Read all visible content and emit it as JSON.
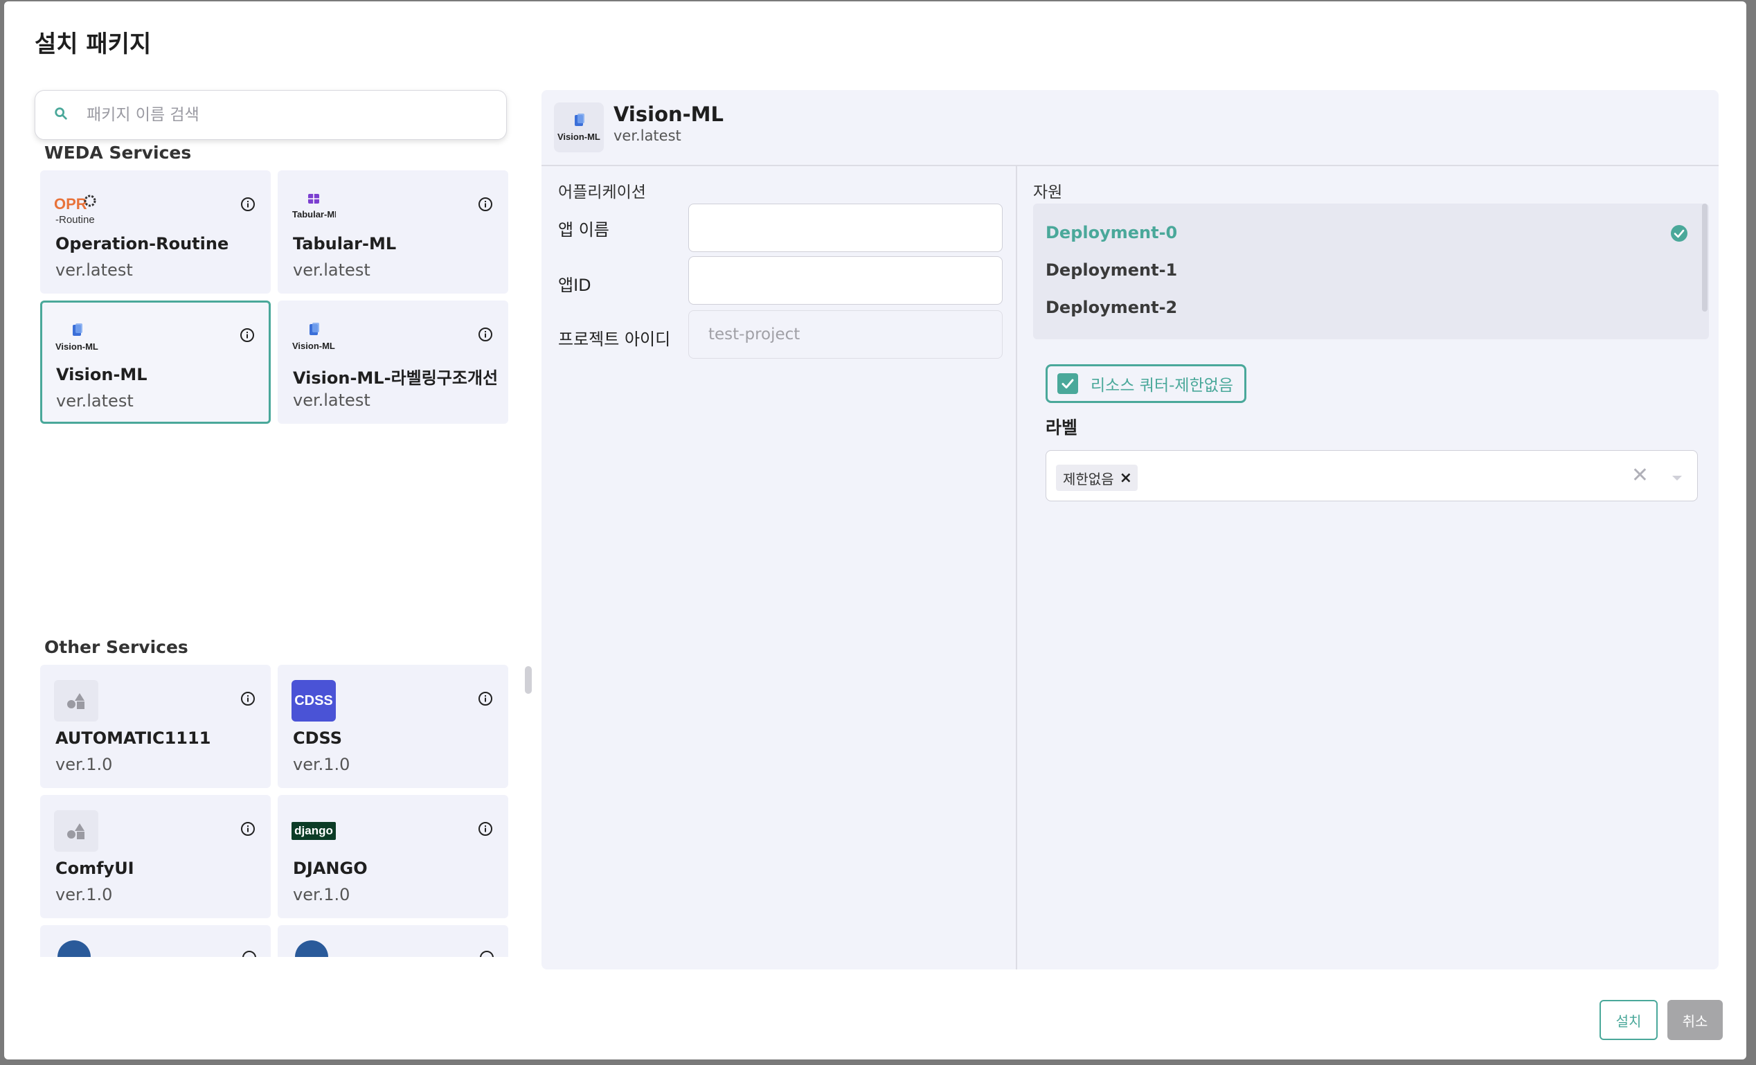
{
  "modal": {
    "title": "설치 패키지"
  },
  "search": {
    "placeholder": "패키지 이름 검색"
  },
  "weda_section": {
    "title": "WEDA Services",
    "cards": [
      {
        "name": "Operation-Routine",
        "version": "ver.latest",
        "logo_text": "OPR",
        "logo_sub": "-Routine"
      },
      {
        "name": "Tabular-ML",
        "version": "ver.latest",
        "logo_text": "Tabular-ML"
      },
      {
        "name": "Vision-ML",
        "version": "ver.latest",
        "logo_text": "Vision-ML",
        "selected": true
      },
      {
        "name": "Vision-ML-라벨링구조개선",
        "version": "ver.latest",
        "logo_text": "Vision-ML"
      }
    ]
  },
  "other_section": {
    "title": "Other Services",
    "cards": [
      {
        "name": "AUTOMATIC1111",
        "version": "ver.1.0"
      },
      {
        "name": "CDSS",
        "version": "ver.1.0",
        "logo_text": "CDSS"
      },
      {
        "name": "ComfyUI",
        "version": "ver.1.0"
      },
      {
        "name": "DJANGO",
        "version": "ver.1.0",
        "logo_text": "django"
      }
    ]
  },
  "detail": {
    "title": "Vision-ML",
    "version": "ver.latest",
    "logo_text": "Vision-ML",
    "application": {
      "section_title": "어플리케이션",
      "app_name_label": "앱 이름",
      "app_name_value": "",
      "app_id_label": "앱ID",
      "app_id_value": "",
      "project_id_label": "프로젝트 아이디",
      "project_id_value": "test-project"
    },
    "resources": {
      "section_title": "자원",
      "deployments": [
        "Deployment-0",
        "Deployment-1",
        "Deployment-2"
      ],
      "selected_deployment": "Deployment-0",
      "quota_label": "리소스 쿼터-제한없음",
      "quota_checked": true,
      "label_title": "라벨",
      "label_chip": "제한없음",
      "clear_symbol": "✕"
    }
  },
  "footer": {
    "install_label": "설치",
    "cancel_label": "취소"
  },
  "colors": {
    "accent": "#4aa89a",
    "panel_bg": "#f2f3fa",
    "card_bg": "#f1f2fa",
    "cdss_logo": "#4a53d6",
    "django_logo": "#0c3c26"
  }
}
